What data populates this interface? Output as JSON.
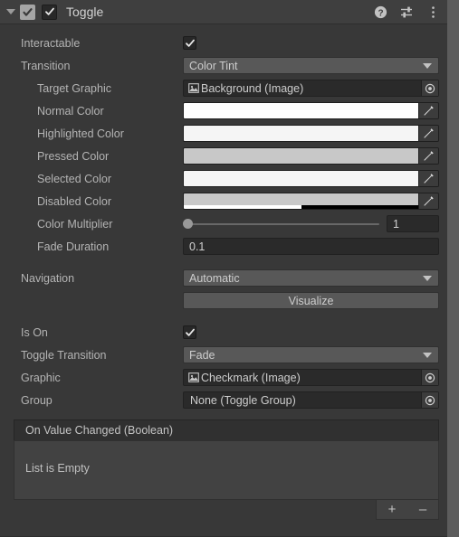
{
  "header": {
    "title": "Toggle",
    "foldout_icon": "triangle-down-icon",
    "component_icon": "toggle-component-icon",
    "enabled_checkbox_icon": "checkmark-icon",
    "help_icon": "help-icon",
    "preset_icon": "preset-icon",
    "menu_icon": "kebab-menu-icon",
    "enabled": true
  },
  "colors": {
    "panel_bg": "#383838",
    "header_bg": "#3f3f3f",
    "label": "#b4b4b4",
    "field_bg": "#2a2a2a",
    "button_bg": "#585858",
    "event_bg": "#424242",
    "scroll_thumb": "#5c5c5c"
  },
  "properties": {
    "interactable": {
      "label": "Interactable",
      "value": true
    },
    "transition": {
      "label": "Transition",
      "value": "Color Tint"
    },
    "target_graphic": {
      "label": "Target Graphic",
      "value": "Background (Image)",
      "icon": "image-asset-icon"
    },
    "normal_color": {
      "label": "Normal Color",
      "value": "#FFFFFF",
      "alpha": 1
    },
    "highlighted_color": {
      "label": "Highlighted Color",
      "value": "#F5F5F5",
      "alpha": 1
    },
    "pressed_color": {
      "label": "Pressed Color",
      "value": "#C8C8C8",
      "alpha": 1
    },
    "selected_color": {
      "label": "Selected Color",
      "value": "#F5F5F5",
      "alpha": 1
    },
    "disabled_color": {
      "label": "Disabled Color",
      "value": "#C8C8C8",
      "alpha": 0.5
    },
    "color_multiplier": {
      "label": "Color Multiplier",
      "value": "1",
      "slider_pct": 0
    },
    "fade_duration": {
      "label": "Fade Duration",
      "value": "0.1"
    },
    "navigation": {
      "label": "Navigation",
      "value": "Automatic"
    },
    "visualize": {
      "label": "Visualize"
    },
    "is_on": {
      "label": "Is On",
      "value": true
    },
    "toggle_transition": {
      "label": "Toggle Transition",
      "value": "Fade"
    },
    "graphic": {
      "label": "Graphic",
      "value": "Checkmark (Image)",
      "icon": "image-asset-icon"
    },
    "group": {
      "label": "Group",
      "value": "None (Toggle Group)",
      "icon": "none-asset-icon"
    }
  },
  "event": {
    "header": "On Value Changed (Boolean)",
    "empty_text": "List is Empty",
    "add_label": "+",
    "remove_label": "–"
  }
}
